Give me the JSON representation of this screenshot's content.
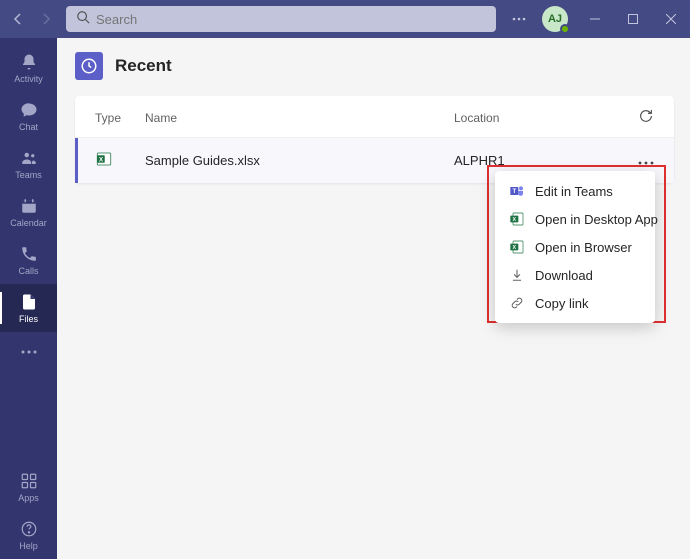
{
  "search": {
    "placeholder": "Search"
  },
  "avatar": {
    "initials": "AJ"
  },
  "sidebar": {
    "items": [
      {
        "label": "Activity"
      },
      {
        "label": "Chat"
      },
      {
        "label": "Teams"
      },
      {
        "label": "Calendar"
      },
      {
        "label": "Calls"
      },
      {
        "label": "Files"
      }
    ],
    "bottom": [
      {
        "label": "Apps"
      },
      {
        "label": "Help"
      }
    ]
  },
  "header": {
    "title": "Recent"
  },
  "table": {
    "headers": {
      "type": "Type",
      "name": "Name",
      "location": "Location"
    },
    "rows": [
      {
        "name": "Sample Guides.xlsx",
        "location": "ALPHR1"
      }
    ]
  },
  "context_menu": {
    "items": [
      {
        "label": "Edit in Teams"
      },
      {
        "label": "Open in Desktop App"
      },
      {
        "label": "Open in Browser"
      },
      {
        "label": "Download"
      },
      {
        "label": "Copy link"
      }
    ]
  }
}
